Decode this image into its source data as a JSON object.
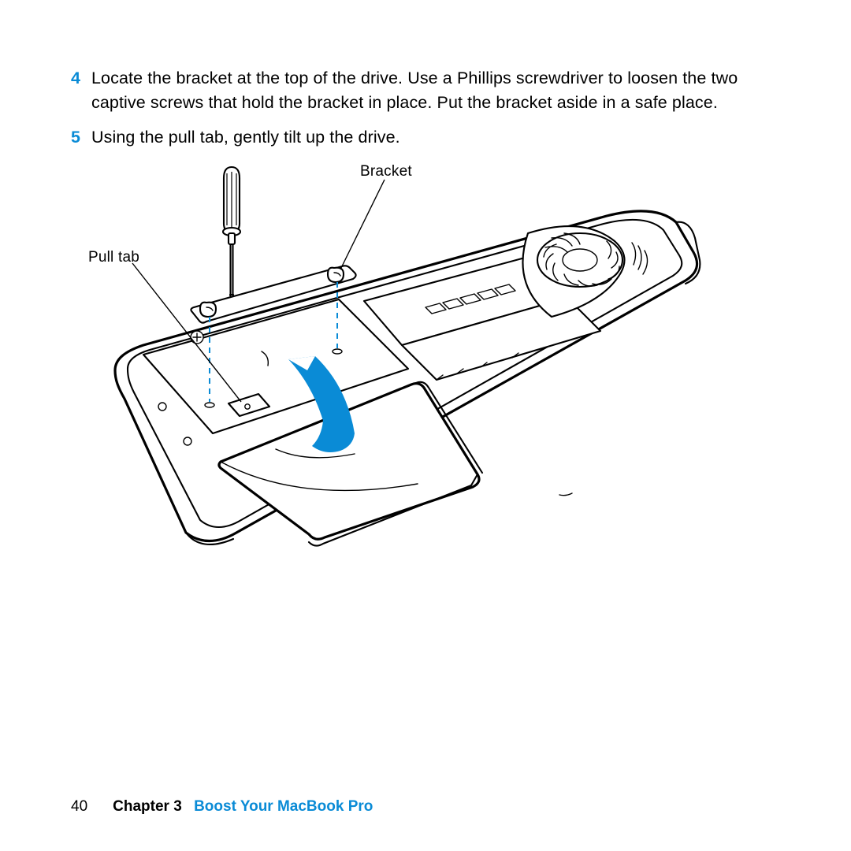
{
  "steps": [
    {
      "num": "4",
      "text": "Locate the bracket at the top of the drive. Use a Phillips screwdriver to loosen the two captive screws that hold the bracket in place. Put the bracket aside in a safe place."
    },
    {
      "num": "5",
      "text": "Using the pull tab, gently tilt up the drive."
    }
  ],
  "figure": {
    "bracket_label": "Bracket",
    "pulltab_label": "Pull tab"
  },
  "footer": {
    "page": "40",
    "chapter_label": "Chapter 3",
    "chapter_title": "Boost Your MacBook Pro"
  }
}
